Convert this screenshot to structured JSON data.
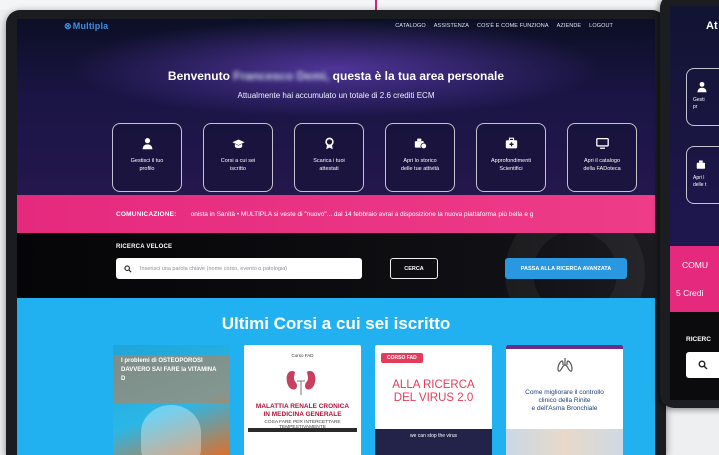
{
  "navbar": {
    "logo": "Multipla",
    "links": [
      "CATALOGO",
      "ASSISTENZA",
      "COS'È E COME FUNZIONA",
      "AZIENDE",
      "LOGOUT"
    ]
  },
  "hero": {
    "welcome_prefix": "Benvenuto",
    "user_name": "Francesco Demi,",
    "welcome_suffix": "questa è la tua area personale",
    "credits_line": "Attualmente hai accumulato un totale di 2.6 crediti ECM",
    "cards": [
      {
        "icon": "user-icon",
        "label": "Gestisci il tuo\nprofilo"
      },
      {
        "icon": "graduation-cap-icon",
        "label": "Corsi a cui sei\niscritto"
      },
      {
        "icon": "award-icon",
        "label": "Scarica i tuoi\nattestati"
      },
      {
        "icon": "history-icon",
        "label": "Apri lo storico\ndelle tue attività"
      },
      {
        "icon": "briefcase-icon",
        "label": "Approfondimenti\nScientifici"
      },
      {
        "icon": "monitor-icon",
        "label": "Apri il catalogo\ndella FADoteca"
      }
    ]
  },
  "ticker": {
    "label": "COMUNICAZIONE:",
    "text": "onista in Sanità  •  MULTIPLA si veste di \"nuovo\"... dal 14 febbraio avrai a disposizione la nuova piattaforma più bella e g"
  },
  "search": {
    "label": "RICERCA VELOCE",
    "placeholder": "Inserisci una parola chiave (nome corso, evento o patologia)",
    "search_button": "CERCA",
    "advanced_button": "PASSA ALLA RICERCA AVANZATA"
  },
  "courses": {
    "title": "Ultimi Corsi a cui sei iscritto",
    "items": [
      {
        "title": "I problemi di OSTEOPOROSI DAVVERO SAI FARE la VITAMINA D"
      },
      {
        "header": "Corso FAD",
        "title": "MALATTIA RENALE CRONICA\nIN MEDICINA GENERALE",
        "subtitle": "COSA FARE PER INTERCETTARE TEMPESTIVAMENTE"
      },
      {
        "badge": "CORSO FAD",
        "title": "ALLA RICERCA\nDEL VIRUS 2.0",
        "footer": "we can stop the virus"
      },
      {
        "title": "Come migliorare il controllo\nclinico della Rinite\ne dell'Asma Bronchiale"
      }
    ]
  },
  "phone": {
    "header_fragment": "At",
    "cards": [
      {
        "label": "Gesti\npr"
      },
      {
        "label": "Apri l\ndelle t"
      }
    ],
    "comunicazione_fragment": "COMU",
    "credits_fragment": "5 Credi",
    "search_label_fragment": "RICERC"
  },
  "colors": {
    "accent_pink": "#e52a7e",
    "accent_blue": "#2a98e0",
    "courses_bg": "#21b1f0"
  }
}
